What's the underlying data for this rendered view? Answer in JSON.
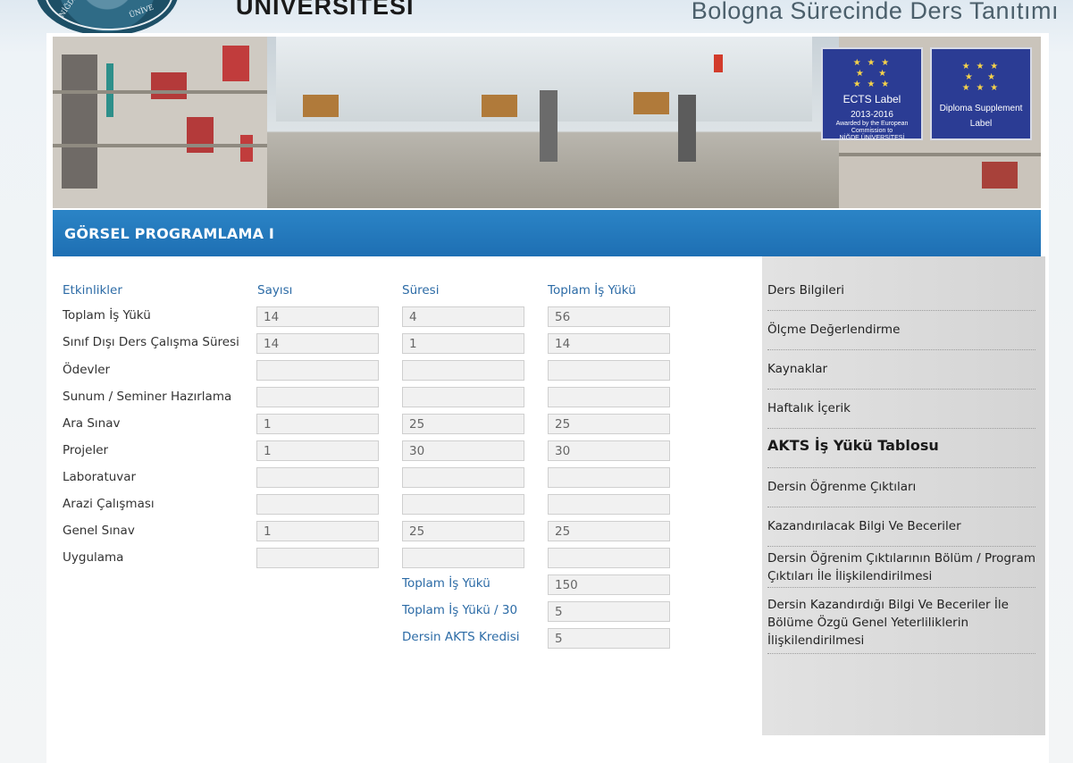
{
  "header": {
    "university": "ÜNİVERSİTESİ",
    "subtitle": "Bologna Sürecinde Ders Tanıtımı",
    "logo_text_left": "NİĞDE",
    "logo_text_right": "ÜNİVE"
  },
  "banner": {
    "badge1": {
      "title": "ECTS Label",
      "years": "2013-2016",
      "note": "Awarded by the European Commission to",
      "org": "NİĞDE ÜNİVERSİTESİ"
    },
    "badge2": {
      "title": "Diploma Supplement",
      "sub": "Label"
    }
  },
  "course": {
    "title": "GÖRSEL PROGRAMLAMA I"
  },
  "table": {
    "headers": {
      "activity": "Etkinlikler",
      "count": "Sayısı",
      "duration": "Süresi",
      "total": "Toplam İş Yükü"
    },
    "rows": [
      {
        "label": "Toplam İş Yükü",
        "count": "14",
        "duration": "4",
        "total": "56"
      },
      {
        "label": "Sınıf Dışı Ders Çalışma Süresi",
        "count": "14",
        "duration": "1",
        "total": "14"
      },
      {
        "label": "Ödevler",
        "count": "",
        "duration": "",
        "total": ""
      },
      {
        "label": "Sunum / Seminer Hazırlama",
        "count": "",
        "duration": "",
        "total": ""
      },
      {
        "label": "Ara Sınav",
        "count": "1",
        "duration": "25",
        "total": "25"
      },
      {
        "label": "Projeler",
        "count": "1",
        "duration": "30",
        "total": "30"
      },
      {
        "label": "Laboratuvar",
        "count": "",
        "duration": "",
        "total": ""
      },
      {
        "label": "Arazi Çalışması",
        "count": "",
        "duration": "",
        "total": ""
      },
      {
        "label": "Genel Sınav",
        "count": "1",
        "duration": "25",
        "total": "25"
      },
      {
        "label": "Uygulama",
        "count": "",
        "duration": "",
        "total": ""
      }
    ],
    "summary": [
      {
        "label": "Toplam İş Yükü",
        "value": "150"
      },
      {
        "label": "Toplam İş Yükü / 30",
        "value": "5"
      },
      {
        "label": "Dersin AKTS Kredisi",
        "value": "5"
      }
    ]
  },
  "sidebar": {
    "items": [
      {
        "label": "Ders Bilgileri"
      },
      {
        "label": "Ölçme Değerlendirme"
      },
      {
        "label": "Kaynaklar"
      },
      {
        "label": "Haftalık İçerik"
      },
      {
        "label": "AKTS İş Yükü Tablosu"
      },
      {
        "label": "Dersin Öğrenme Çıktıları"
      },
      {
        "label": "Kazandırılacak Bilgi Ve Beceriler"
      },
      {
        "label": "Dersin Öğrenim Çıktılarının Bölüm / Program Çıktıları İle İlişkilendirilmesi"
      },
      {
        "label": "Dersin Kazandırdığı Bilgi Ve Beceriler İle Bölüme Özgü Genel Yeterliliklerin İlişkilendirilmesi"
      }
    ],
    "active_index": 4
  }
}
